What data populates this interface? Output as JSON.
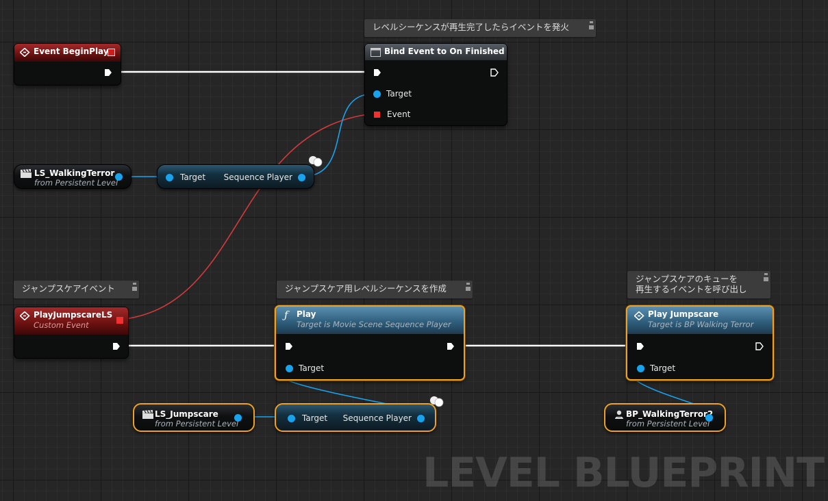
{
  "comments": {
    "bind_note": "レベルシーケンスが再生完了したらイベントを発火",
    "jumpscare_event_note": "ジャンプスケアイベント",
    "create_ls_note": "ジャンプスケア用レベルシーケンスを作成",
    "cue_note_line1": "ジャンプスケアのキューを",
    "cue_note_line2": "再生するイベントを呼び出し"
  },
  "nodes": {
    "begin_play": {
      "title": "Event BeginPlay"
    },
    "bind_event": {
      "title": "Bind Event to On Finished",
      "target_label": "Target",
      "event_label": "Event"
    },
    "ls_walking": {
      "title": "LS_WalkingTerror",
      "subtitle": "from Persistent Level"
    },
    "seq_player_1": {
      "target_label": "Target",
      "output_label": "Sequence Player"
    },
    "custom_event": {
      "title": "PlayJumpscareLS",
      "subtitle": "Custom Event"
    },
    "play": {
      "title": "Play",
      "subtitle": "Target is Movie Scene Sequence Player",
      "target_label": "Target"
    },
    "play_jumpscare": {
      "title": "Play Jumpscare",
      "subtitle": "Target is BP Walking Terror",
      "target_label": "Target"
    },
    "ls_jumpscare": {
      "title": "LS_Jumpscare",
      "subtitle": "from Persistent Level"
    },
    "seq_player_2": {
      "target_label": "Target",
      "output_label": "Sequence Player"
    },
    "bp_walking2": {
      "title": "BP_WalkingTerror2",
      "subtitle": "from Persistent Level"
    }
  },
  "watermark": "LEVEL BLUEPRINT",
  "colors": {
    "exec_wire": "#ffffff",
    "object_pin": "#17a3ee",
    "delegate_pin": "#ef3131",
    "selection": "#f0a121"
  }
}
